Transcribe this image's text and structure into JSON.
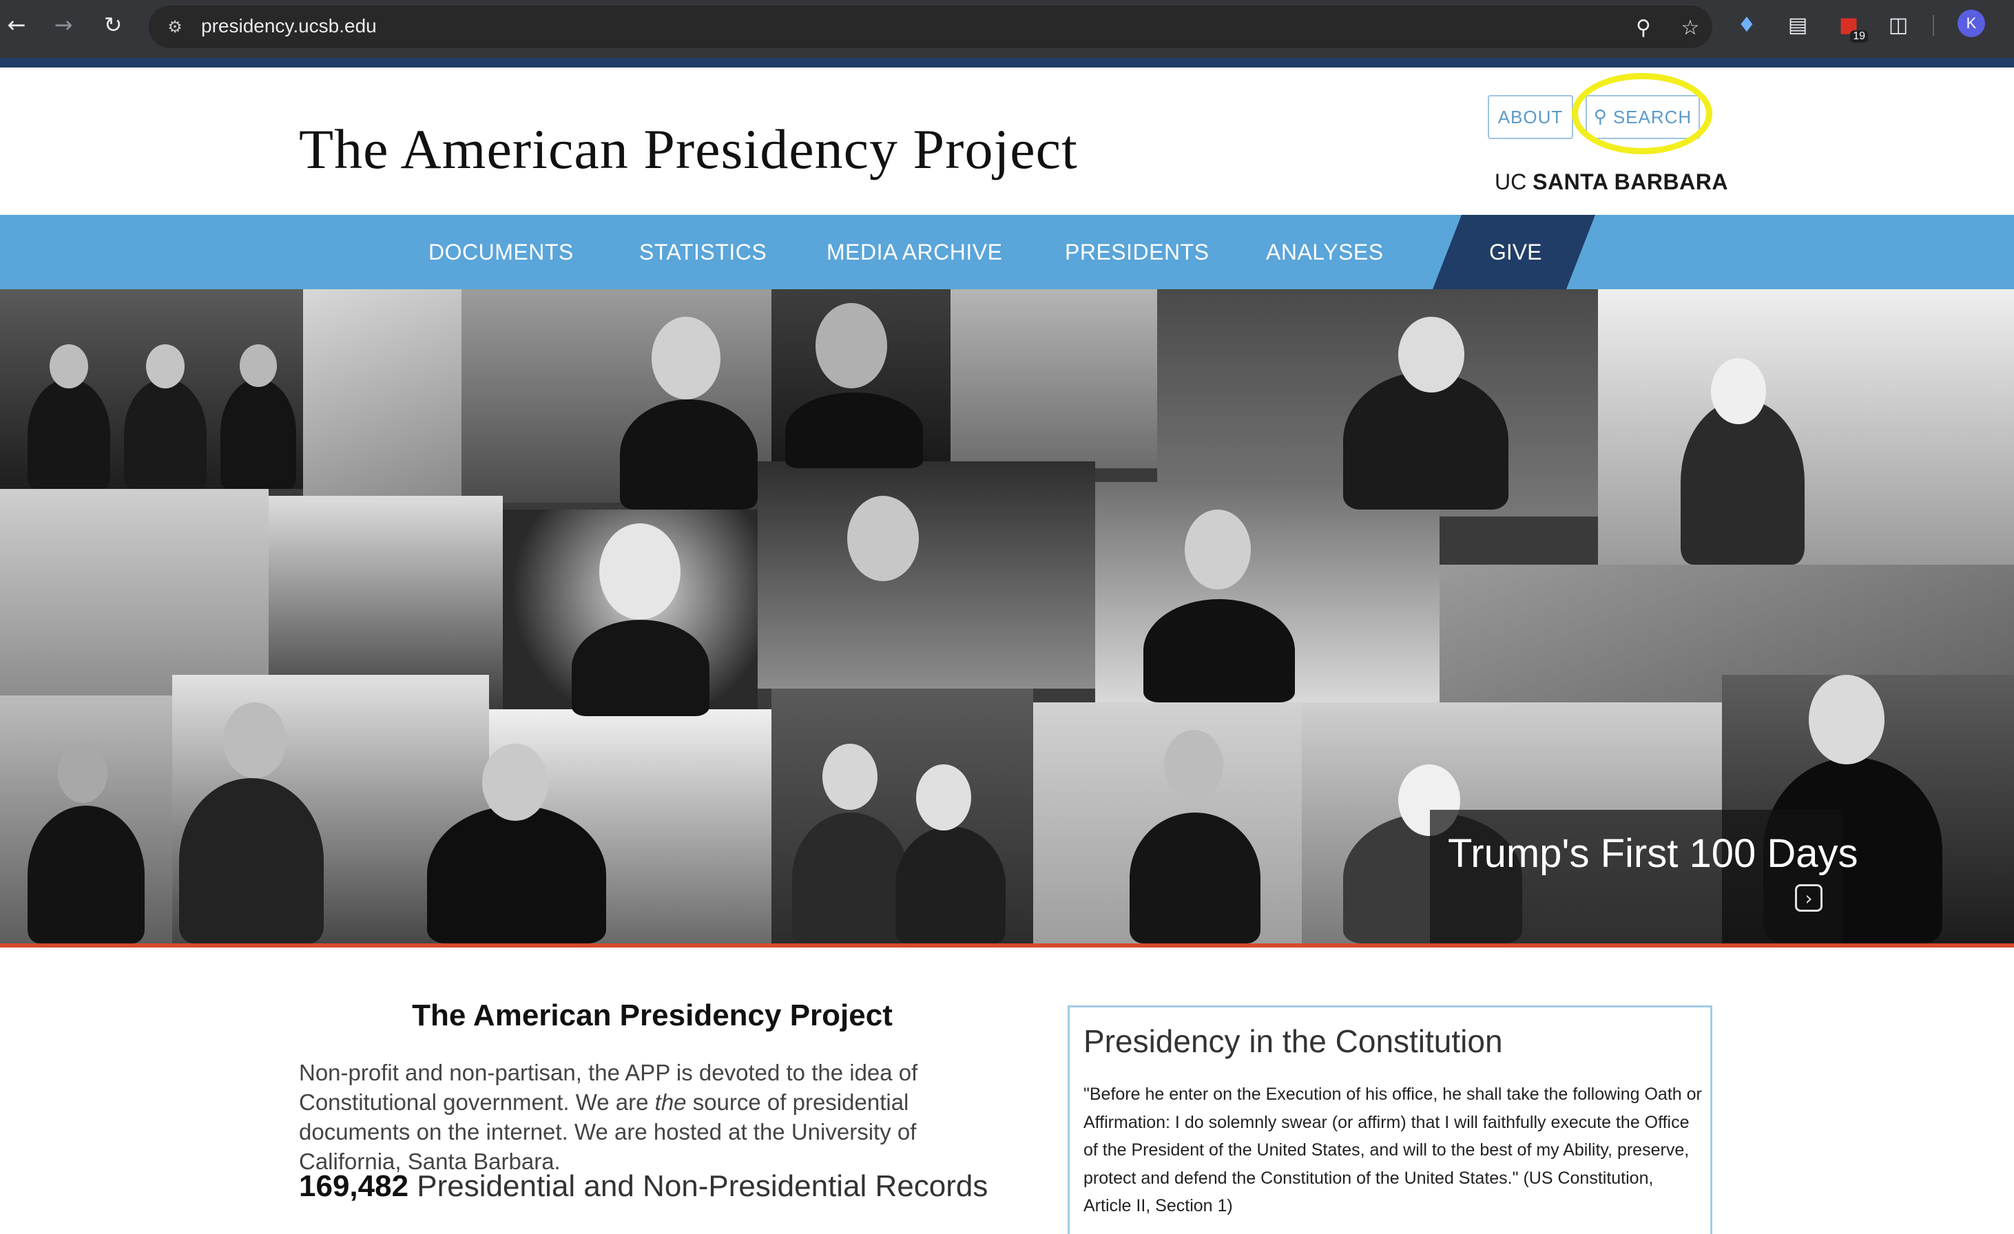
{
  "browser": {
    "url": "presidency.ucsb.edu",
    "extension_badge": "19",
    "profile_initial": "K",
    "icons": [
      "back-icon",
      "forward-icon",
      "reload-icon",
      "site-info-icon",
      "zoom-icon",
      "bookmark-star-icon",
      "gem-extension-icon",
      "document-extension-icon",
      "red-extension-icon",
      "puzzle-extensions-icon"
    ]
  },
  "header": {
    "title": "The American Presidency Project",
    "about_label": "ABOUT",
    "search_label": "SEARCH",
    "university_prefix": "UC",
    "university_name": "SANTA BARBARA",
    "highlight_color": "#f3ee1d"
  },
  "nav": {
    "items": [
      "DOCUMENTS",
      "STATISTICS",
      "MEDIA ARCHIVE",
      "PRESIDENTS",
      "ANALYSES"
    ],
    "give_label": "GIVE",
    "bar_color": "#5aa5d9",
    "give_color": "#1f3d66"
  },
  "hero": {
    "caption": "Trump's First 100 Days",
    "accent_color": "#d64a2a"
  },
  "about": {
    "title": "The American Presidency Project",
    "text_before": "Non-profit and non-partisan, the APP is devoted to the idea of Constitutional government. We are ",
    "text_emphasis": "the",
    "text_after": " source of presidential documents on the internet.  We are hosted at the University of California, Santa Barbara.",
    "records_count": "169,482",
    "records_label": " Presidential and Non-Presidential Records"
  },
  "constitution": {
    "title": "Presidency in the Constitution",
    "quote": "\"Before he enter on the Execution of his office, he shall take the following Oath or Affirmation:  I do solemnly swear (or affirm) that I will faithfully execute the Office of the President of the United States, and will to the best of my Ability, preserve, protect and defend the Constitution of the United States.\" (US Constitution, Article II, Section 1)"
  }
}
